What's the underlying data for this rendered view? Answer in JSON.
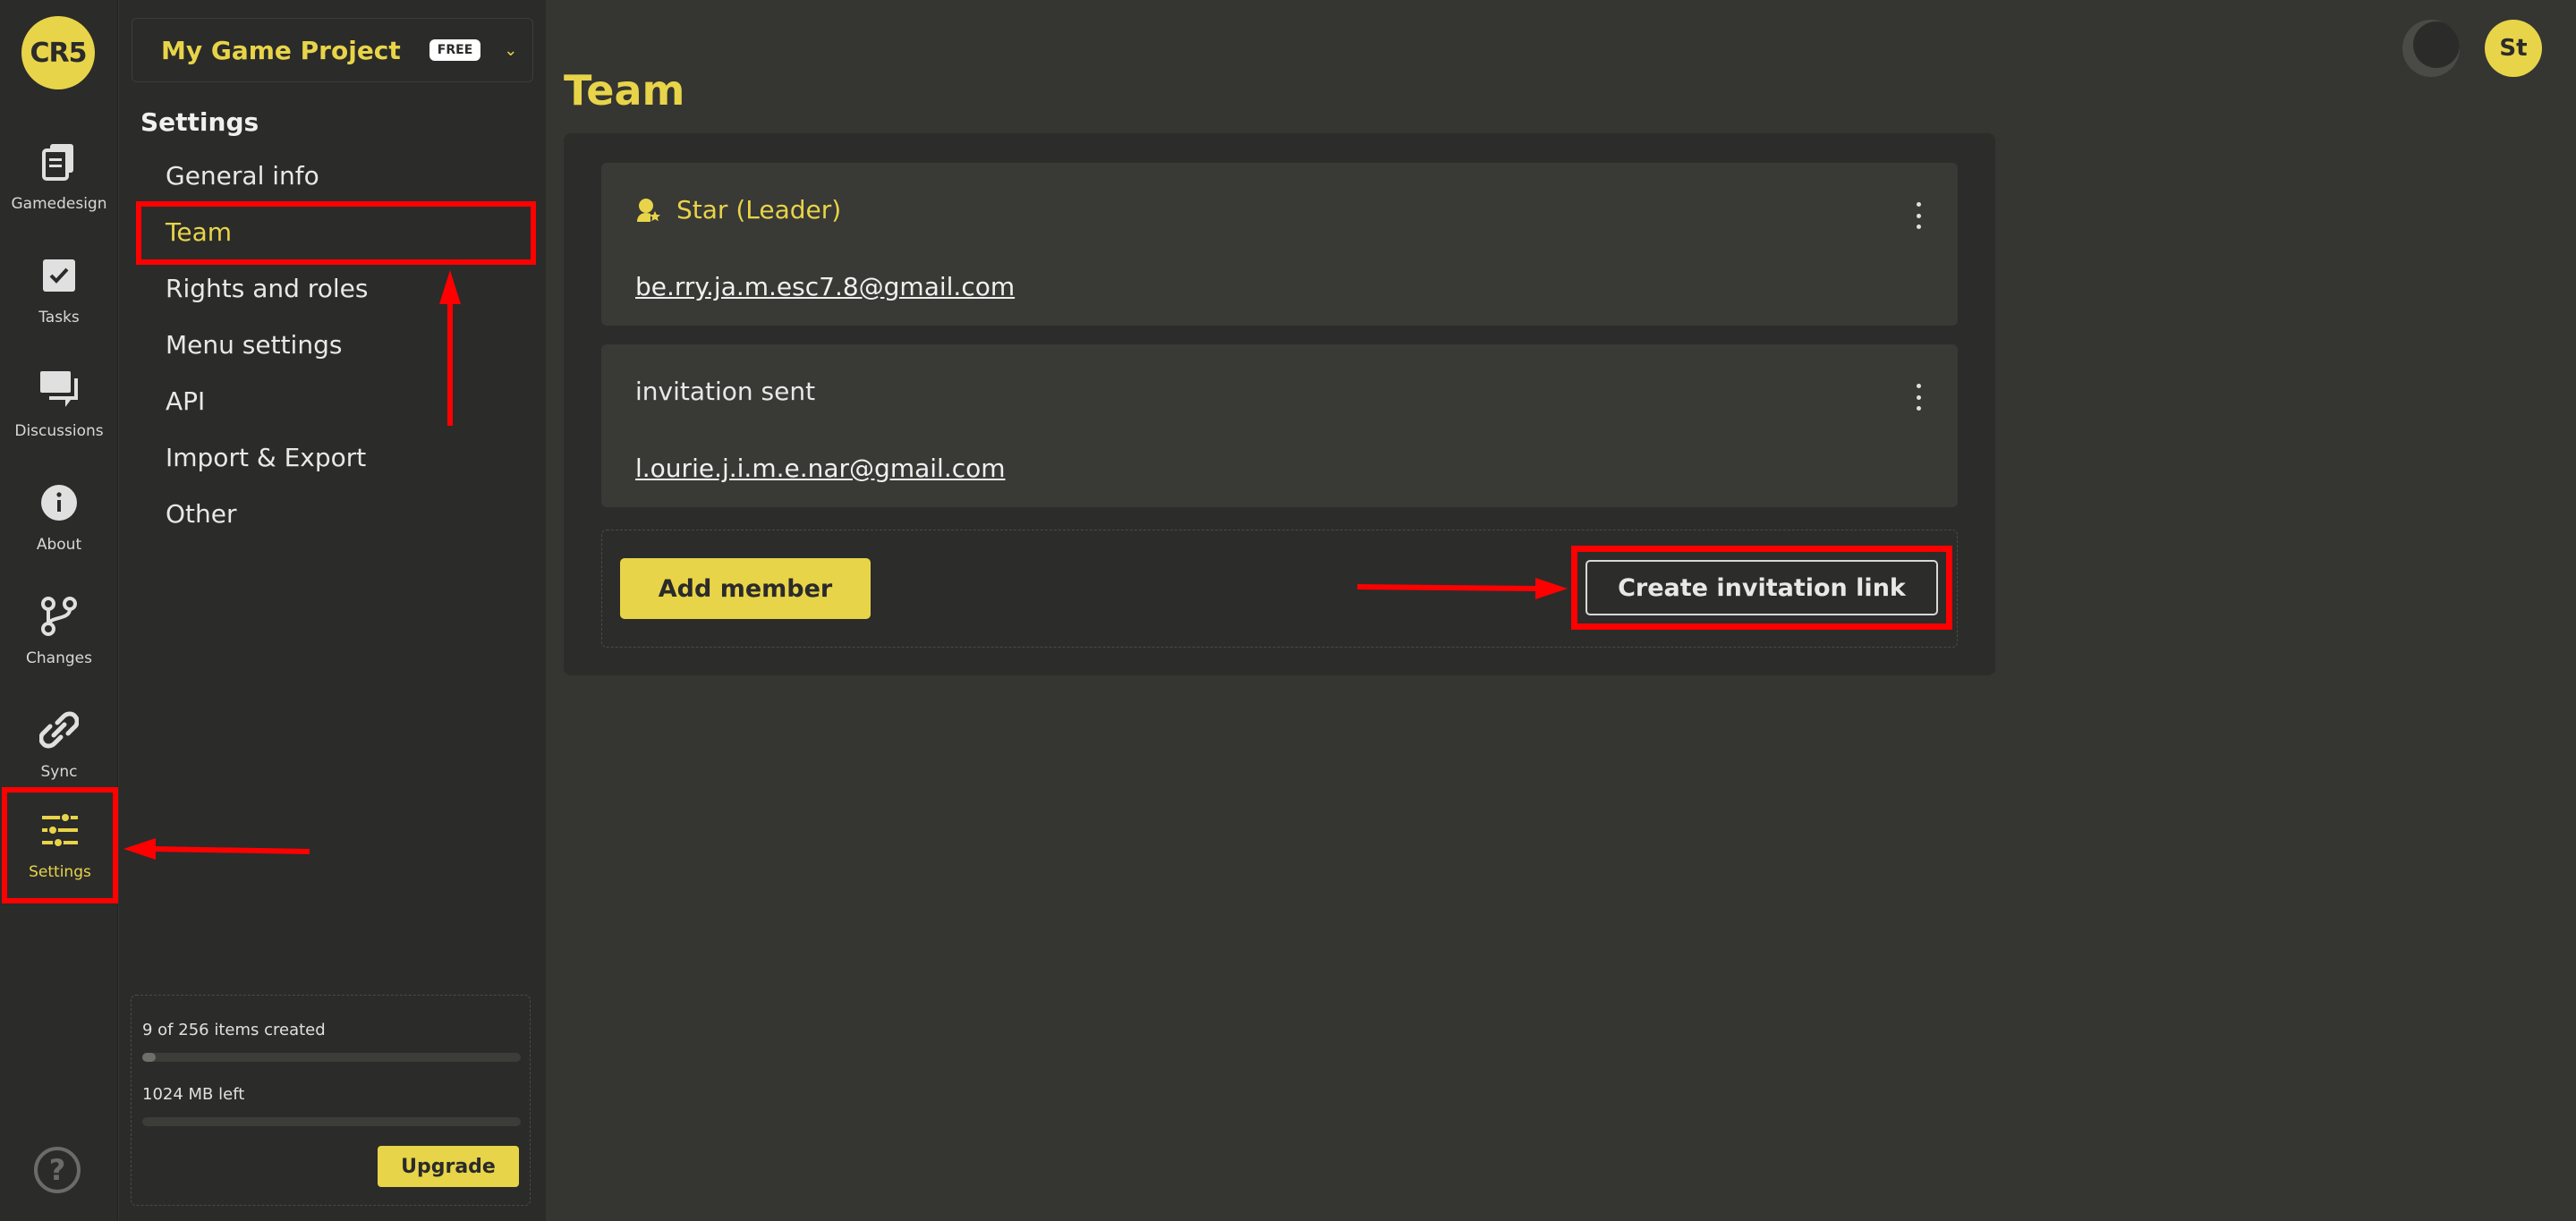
{
  "logo_text": "CR5",
  "rail": {
    "items": [
      {
        "label": "Gamedesign"
      },
      {
        "label": "Tasks"
      },
      {
        "label": "Discussions"
      },
      {
        "label": "About"
      },
      {
        "label": "Changes"
      },
      {
        "label": "Sync"
      },
      {
        "label": "Settings"
      }
    ],
    "help_glyph": "?"
  },
  "project": {
    "name": "My Game Project",
    "plan_badge": "FREE"
  },
  "settings": {
    "heading": "Settings",
    "menu": [
      {
        "label": "General info"
      },
      {
        "label": "Team"
      },
      {
        "label": "Rights and roles"
      },
      {
        "label": "Menu settings"
      },
      {
        "label": "API"
      },
      {
        "label": "Import & Export"
      },
      {
        "label": "Other"
      }
    ],
    "active": "Team"
  },
  "quota": {
    "items_text": "9 of 256 items created",
    "items_fraction": 0.035,
    "storage_text": "1024 MB left",
    "storage_fraction": 0.0,
    "upgrade_label": "Upgrade"
  },
  "main": {
    "title": "Team",
    "members": [
      {
        "title": "Star (Leader)",
        "email": "be.rry.ja.m.esc7.8@gmail.com",
        "role_icon": "leader-badge-icon"
      },
      {
        "title": "invitation sent",
        "email": "l.ourie.j.i.m.e.nar@gmail.com"
      }
    ],
    "add_member_label": "Add member",
    "create_invite_label": "Create invitation link"
  },
  "header": {
    "avatar_initials": "St"
  },
  "colors": {
    "accent": "#e8d449",
    "annotation": "#ff0000",
    "background": "#353531",
    "panel": "#2b2b2a"
  }
}
